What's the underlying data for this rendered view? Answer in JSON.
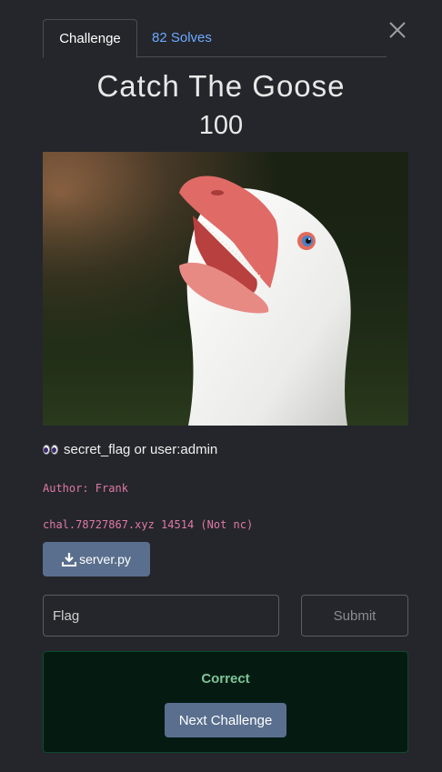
{
  "tabs": [
    {
      "label": "Challenge",
      "active": true
    },
    {
      "label": "82 Solves",
      "active": false
    }
  ],
  "challenge": {
    "title": "Catch The Goose",
    "points": "100",
    "description": "secret_flag or user:admin",
    "author": "Author: Frank",
    "host": "chal.78727867.xyz 14514 (Not nc)"
  },
  "files": {
    "download_label": "server.py"
  },
  "form": {
    "flag_placeholder": "Flag",
    "submit_label": "Submit"
  },
  "result": {
    "message": "Correct",
    "next_label": "Next Challenge"
  },
  "colors": {
    "background": "#24262b",
    "accent_button": "#5a6f8e",
    "link": "#6ea8fe",
    "mono_text": "#e178a7",
    "success_bg": "#051b11",
    "success_text": "#7ec49a"
  },
  "icons": {
    "close": "close-icon",
    "download": "download-icon",
    "eyes": "eyes-emoji-icon"
  }
}
